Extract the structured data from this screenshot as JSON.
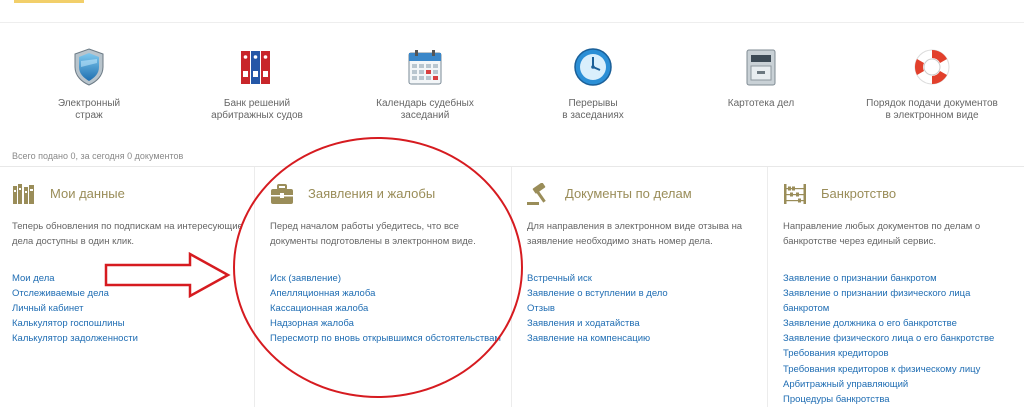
{
  "services": [
    {
      "icon": "shield-icon",
      "label": "Электронный\nстраж"
    },
    {
      "icon": "binders-icon",
      "label": "Банк решений\nарбитражных судов"
    },
    {
      "icon": "calendar-icon",
      "label": "Календарь судебных\nзаседаний"
    },
    {
      "icon": "clock-icon",
      "label": "Перерывы\nв заседаниях"
    },
    {
      "icon": "cabinet-icon",
      "label": "Картотека дел"
    },
    {
      "icon": "lifebuoy-icon",
      "label": "Порядок подачи документов\nв электронном виде"
    }
  ],
  "counter": "Всего подано 0, за сегодня 0 документов",
  "columns": [
    {
      "title": "Мои данные",
      "icon": "books-icon",
      "description": "Теперь обновления по подпискам на интересующие дела доступны в один клик.",
      "links": [
        "Мои дела",
        "Отслеживаемые дела",
        "Личный кабинет",
        "Калькулятор госпошлины",
        "Калькулятор задолженности"
      ]
    },
    {
      "title": "Заявления и жалобы",
      "icon": "briefcase-icon",
      "description": "Перед началом работы убедитесь, что все документы подготовлены в электронном виде.",
      "links": [
        "Иск (заявление)",
        "Апелляционная жалоба",
        "Кассационная жалоба",
        "Надзорная жалоба",
        "Пересмотр по вновь открывшимся обстоятельствам"
      ]
    },
    {
      "title": "Документы по делам",
      "icon": "gavel-icon",
      "description": "Для направления в электронном виде отзыва на заявление необходимо знать номер дела.",
      "links": [
        "Встречный иск",
        "Заявление о вступлении в дело",
        "Отзыв",
        "Заявления и ходатайства",
        "Заявление на компенсацию"
      ]
    },
    {
      "title": "Банкротство",
      "icon": "abacus-icon",
      "description": "Направление любых документов по делам о банкротстве через единый сервис.",
      "links": [
        "Заявление о признании банкротом",
        "Заявление о признании физического лица",
        "банкротом",
        "Заявление должника о его банкротстве",
        "Заявление физического лица о его банкротстве",
        "Требования кредиторов",
        "Требования кредиторов к физическому лицу",
        "Арбитражный управляющий",
        "Процедуры банкротства"
      ]
    }
  ],
  "colors": {
    "accent": "#9a8d59",
    "link": "#1f6db3",
    "annotation": "#d61b20"
  }
}
